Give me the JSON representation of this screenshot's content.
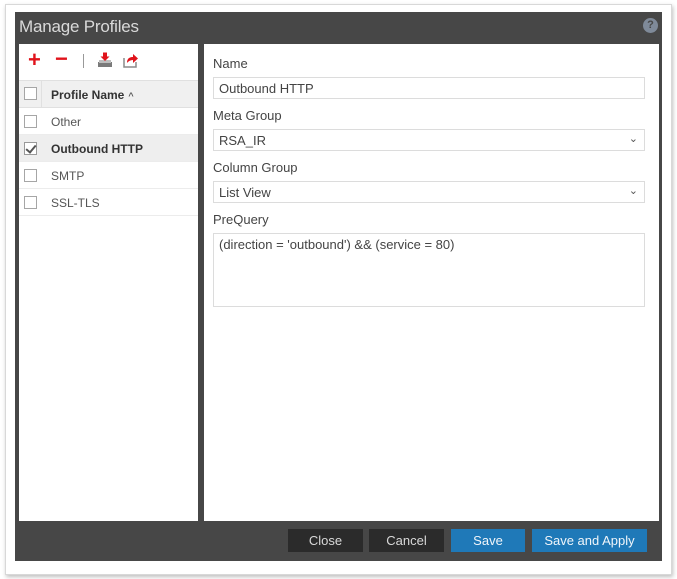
{
  "dialog": {
    "title": "Manage Profiles",
    "help_icon": "?"
  },
  "toolbar": {
    "add_icon": "+",
    "remove_icon": "−",
    "import_icon": "import-icon",
    "export_icon": "export-icon"
  },
  "grid": {
    "header": {
      "label": "Profile Name",
      "sort_icon": "^"
    },
    "rows": [
      {
        "label": "Other",
        "checked": false,
        "selected": false
      },
      {
        "label": "Outbound HTTP",
        "checked": true,
        "selected": true
      },
      {
        "label": "SMTP",
        "checked": false,
        "selected": false
      },
      {
        "label": "SSL-TLS",
        "checked": false,
        "selected": false
      }
    ]
  },
  "form": {
    "name_label": "Name",
    "name_value": "Outbound HTTP",
    "meta_group_label": "Meta Group",
    "meta_group_value": "RSA_IR",
    "column_group_label": "Column Group",
    "column_group_value": "List View",
    "prequery_label": "PreQuery",
    "prequery_value": "(direction = 'outbound') && (service = 80)",
    "chevron": "⌄"
  },
  "footer": {
    "close_label": "Close",
    "cancel_label": "Cancel",
    "save_label": "Save",
    "save_apply_label": "Save and Apply"
  },
  "colors": {
    "dialog_bg": "#474747",
    "accent_red": "#e0131b",
    "primary_blue": "#1f79b8",
    "dark_button": "#2b2b2b"
  }
}
